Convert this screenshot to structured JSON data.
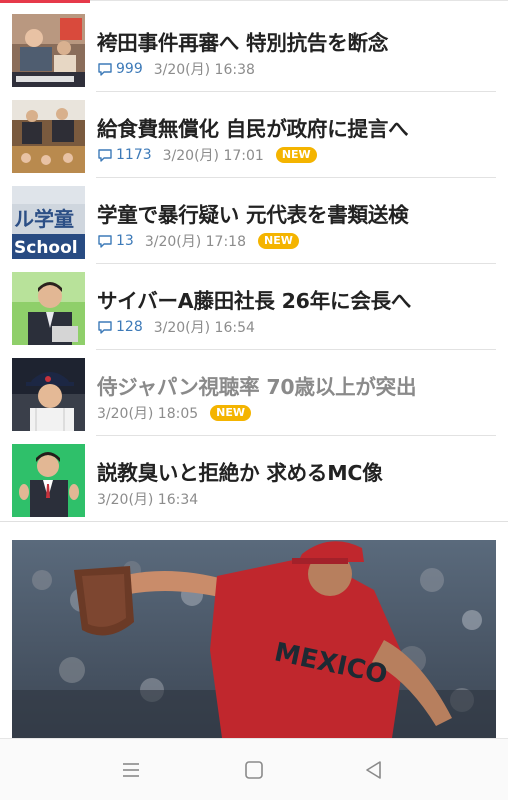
{
  "news_items": [
    {
      "title": "袴田事件再審へ 特別抗告を断念",
      "comments": "999",
      "time": "3/20(月) 16:38",
      "is_new": false,
      "read": false,
      "thumb_icon": "press-conference-photo"
    },
    {
      "title": "給食費無償化 自民が政府に提言へ",
      "comments": "1173",
      "time": "3/20(月) 17:01",
      "is_new": true,
      "read": false,
      "thumb_icon": "school-lunch-photo"
    },
    {
      "title": "学童で暴行疑い 元代表を書類送検",
      "comments": "13",
      "time": "3/20(月) 17:18",
      "is_new": true,
      "read": false,
      "thumb_icon": "school-sign-photo"
    },
    {
      "title": "サイバーA藤田社長 26年に会長へ",
      "comments": "128",
      "time": "3/20(月) 16:54",
      "is_new": false,
      "read": false,
      "thumb_icon": "businessman-portrait-photo"
    },
    {
      "title": "侍ジャパン視聴率 70歳以上が突出",
      "comments": "",
      "time": "3/20(月) 18:05",
      "is_new": true,
      "read": true,
      "thumb_icon": "baseball-player-photo"
    },
    {
      "title": "説教臭いと拒絶か 求めるMC像",
      "comments": "",
      "time": "3/20(月) 16:34",
      "is_new": false,
      "read": false,
      "thumb_icon": "tv-host-photo"
    }
  ],
  "new_badge_label": "NEW",
  "featured_photo": {
    "icon": "baseball-pitcher-photo",
    "jersey_text": "MEXICO"
  },
  "nav": {
    "menu_icon": "menu-icon",
    "home_icon": "home-square-icon",
    "back_icon": "back-triangle-icon"
  },
  "colors": {
    "accent": "#e6394a",
    "comment": "#3d7ab8",
    "new_badge": "#f4b400",
    "title": "#222222",
    "read_title": "#8a8a8a",
    "meta": "#8c8c8c"
  }
}
